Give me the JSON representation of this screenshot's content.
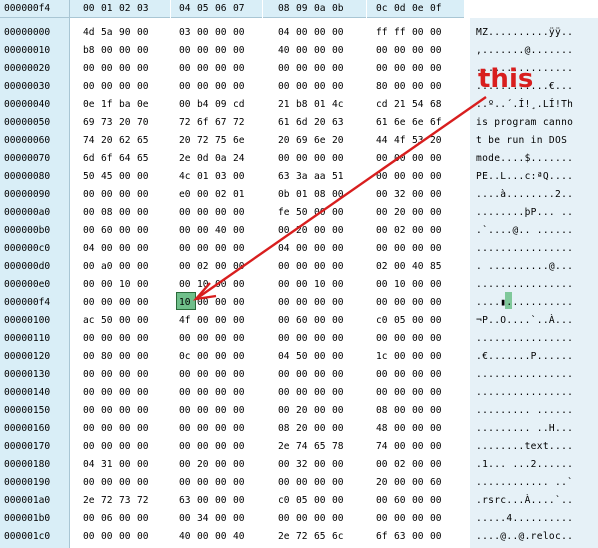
{
  "header": {
    "corner_label": "000000f4",
    "columns": [
      "00",
      "01",
      "02",
      "03",
      "04",
      "05",
      "06",
      "07",
      "08",
      "09",
      "0a",
      "0b",
      "0c",
      "0d",
      "0e",
      "0f"
    ]
  },
  "rows": [
    {
      "offset": "00000000",
      "bytes": [
        "4d",
        "5a",
        "90",
        "00",
        "03",
        "00",
        "00",
        "00",
        "04",
        "00",
        "00",
        "00",
        "ff",
        "ff",
        "00",
        "00"
      ],
      "ascii": "MZ..........ÿÿ.."
    },
    {
      "offset": "00000010",
      "bytes": [
        "b8",
        "00",
        "00",
        "00",
        "00",
        "00",
        "00",
        "00",
        "40",
        "00",
        "00",
        "00",
        "00",
        "00",
        "00",
        "00"
      ],
      "ascii": ",.......@......."
    },
    {
      "offset": "00000020",
      "bytes": [
        "00",
        "00",
        "00",
        "00",
        "00",
        "00",
        "00",
        "00",
        "00",
        "00",
        "00",
        "00",
        "00",
        "00",
        "00",
        "00"
      ],
      "ascii": "................"
    },
    {
      "offset": "00000030",
      "bytes": [
        "00",
        "00",
        "00",
        "00",
        "00",
        "00",
        "00",
        "00",
        "00",
        "00",
        "00",
        "00",
        "80",
        "00",
        "00",
        "00"
      ],
      "ascii": "............€..."
    },
    {
      "offset": "00000040",
      "bytes": [
        "0e",
        "1f",
        "ba",
        "0e",
        "00",
        "b4",
        "09",
        "cd",
        "21",
        "b8",
        "01",
        "4c",
        "cd",
        "21",
        "54",
        "68"
      ],
      "ascii": "..º..´.Í!¸.LÍ!Th"
    },
    {
      "offset": "00000050",
      "bytes": [
        "69",
        "73",
        "20",
        "70",
        "72",
        "6f",
        "67",
        "72",
        "61",
        "6d",
        "20",
        "63",
        "61",
        "6e",
        "6e",
        "6f"
      ],
      "ascii": "is program canno"
    },
    {
      "offset": "00000060",
      "bytes": [
        "74",
        "20",
        "62",
        "65",
        "20",
        "72",
        "75",
        "6e",
        "20",
        "69",
        "6e",
        "20",
        "44",
        "4f",
        "53",
        "20"
      ],
      "ascii": "t be run in DOS "
    },
    {
      "offset": "00000070",
      "bytes": [
        "6d",
        "6f",
        "64",
        "65",
        "2e",
        "0d",
        "0a",
        "24",
        "00",
        "00",
        "00",
        "00",
        "00",
        "00",
        "00",
        "00"
      ],
      "ascii": "mode....$......."
    },
    {
      "offset": "00000080",
      "bytes": [
        "50",
        "45",
        "00",
        "00",
        "4c",
        "01",
        "03",
        "00",
        "63",
        "3a",
        "aa",
        "51",
        "00",
        "00",
        "00",
        "00"
      ],
      "ascii": "PE..L...c:ªQ...."
    },
    {
      "offset": "00000090",
      "bytes": [
        "00",
        "00",
        "00",
        "00",
        "e0",
        "00",
        "02",
        "01",
        "0b",
        "01",
        "08",
        "00",
        "00",
        "32",
        "00",
        "00"
      ],
      "ascii": "....à........2.."
    },
    {
      "offset": "000000a0",
      "bytes": [
        "00",
        "08",
        "00",
        "00",
        "00",
        "00",
        "00",
        "00",
        "fe",
        "50",
        "00",
        "00",
        "00",
        "20",
        "00",
        "00"
      ],
      "ascii": "........þP... .."
    },
    {
      "offset": "000000b0",
      "bytes": [
        "00",
        "60",
        "00",
        "00",
        "00",
        "00",
        "40",
        "00",
        "00",
        "20",
        "00",
        "00",
        "00",
        "02",
        "00",
        "00"
      ],
      "ascii": ".`....@.. ......"
    },
    {
      "offset": "000000c0",
      "bytes": [
        "04",
        "00",
        "00",
        "00",
        "00",
        "00",
        "00",
        "00",
        "04",
        "00",
        "00",
        "00",
        "00",
        "00",
        "00",
        "00"
      ],
      "ascii": "................"
    },
    {
      "offset": "000000d0",
      "bytes": [
        "00",
        "a0",
        "00",
        "00",
        "00",
        "02",
        "00",
        "00",
        "00",
        "00",
        "00",
        "00",
        "02",
        "00",
        "40",
        "85"
      ],
      "ascii": ". ..........@..."
    },
    {
      "offset": "000000e0",
      "bytes": [
        "00",
        "00",
        "10",
        "00",
        "00",
        "10",
        "00",
        "00",
        "00",
        "00",
        "10",
        "00",
        "00",
        "10",
        "00",
        "00"
      ],
      "ascii": "................"
    },
    {
      "offset": "000000f4",
      "bytes": [
        "00",
        "00",
        "00",
        "00",
        "10",
        "00",
        "00",
        "00",
        "00",
        "00",
        "00",
        "00",
        "00",
        "00",
        "00",
        "00"
      ],
      "ascii": "....▮..........."
    },
    {
      "offset": "00000100",
      "bytes": [
        "ac",
        "50",
        "00",
        "00",
        "4f",
        "00",
        "00",
        "00",
        "00",
        "60",
        "00",
        "00",
        "c0",
        "05",
        "00",
        "00"
      ],
      "ascii": "¬P..O....`..À..."
    },
    {
      "offset": "00000110",
      "bytes": [
        "00",
        "00",
        "00",
        "00",
        "00",
        "00",
        "00",
        "00",
        "00",
        "00",
        "00",
        "00",
        "00",
        "00",
        "00",
        "00"
      ],
      "ascii": "................"
    },
    {
      "offset": "00000120",
      "bytes": [
        "00",
        "80",
        "00",
        "00",
        "0c",
        "00",
        "00",
        "00",
        "04",
        "50",
        "00",
        "00",
        "1c",
        "00",
        "00",
        "00"
      ],
      "ascii": ".€.......P......"
    },
    {
      "offset": "00000130",
      "bytes": [
        "00",
        "00",
        "00",
        "00",
        "00",
        "00",
        "00",
        "00",
        "00",
        "00",
        "00",
        "00",
        "00",
        "00",
        "00",
        "00"
      ],
      "ascii": "................"
    },
    {
      "offset": "00000140",
      "bytes": [
        "00",
        "00",
        "00",
        "00",
        "00",
        "00",
        "00",
        "00",
        "00",
        "00",
        "00",
        "00",
        "00",
        "00",
        "00",
        "00"
      ],
      "ascii": "................"
    },
    {
      "offset": "00000150",
      "bytes": [
        "00",
        "00",
        "00",
        "00",
        "00",
        "00",
        "00",
        "00",
        "00",
        "20",
        "00",
        "00",
        "08",
        "00",
        "00",
        "00"
      ],
      "ascii": "......... ......"
    },
    {
      "offset": "00000160",
      "bytes": [
        "00",
        "00",
        "00",
        "00",
        "00",
        "00",
        "00",
        "00",
        "08",
        "20",
        "00",
        "00",
        "48",
        "00",
        "00",
        "00"
      ],
      "ascii": "......... ..H..."
    },
    {
      "offset": "00000170",
      "bytes": [
        "00",
        "00",
        "00",
        "00",
        "00",
        "00",
        "00",
        "00",
        "2e",
        "74",
        "65",
        "78",
        "74",
        "00",
        "00",
        "00"
      ],
      "ascii": "........text...."
    },
    {
      "offset": "00000180",
      "bytes": [
        "04",
        "31",
        "00",
        "00",
        "00",
        "20",
        "00",
        "00",
        "00",
        "32",
        "00",
        "00",
        "00",
        "02",
        "00",
        "00"
      ],
      "ascii": ".1... ...2......"
    },
    {
      "offset": "00000190",
      "bytes": [
        "00",
        "00",
        "00",
        "00",
        "00",
        "00",
        "00",
        "00",
        "00",
        "00",
        "00",
        "00",
        "20",
        "00",
        "00",
        "60"
      ],
      "ascii": "............ ..`"
    },
    {
      "offset": "000001a0",
      "bytes": [
        "2e",
        "72",
        "73",
        "72",
        "63",
        "00",
        "00",
        "00",
        "c0",
        "05",
        "00",
        "00",
        "00",
        "60",
        "00",
        "00"
      ],
      "ascii": ".rsrc...À....`.."
    },
    {
      "offset": "000001b0",
      "bytes": [
        "00",
        "06",
        "00",
        "00",
        "00",
        "34",
        "00",
        "00",
        "00",
        "00",
        "00",
        "00",
        "00",
        "00",
        "00",
        "00"
      ],
      "ascii": ".....4.........."
    },
    {
      "offset": "000001c0",
      "bytes": [
        "00",
        "00",
        "00",
        "00",
        "40",
        "00",
        "00",
        "40",
        "2e",
        "72",
        "65",
        "6c",
        "6f",
        "63",
        "00",
        "00"
      ],
      "ascii": "....@..@.reloc.."
    }
  ],
  "annotation": {
    "text": "this",
    "color": "#d81e1e"
  },
  "highlight": {
    "row": 15,
    "col": 4,
    "color": "#6fbf8a"
  },
  "colors": {
    "offset_bg": "#d9eef7",
    "ascii_bg": "#e6f1f7"
  }
}
